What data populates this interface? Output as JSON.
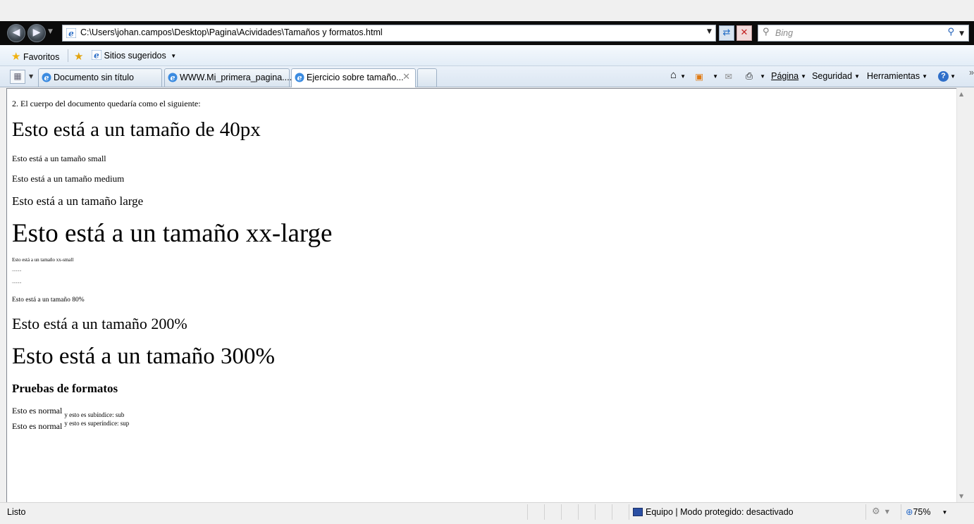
{
  "address_bar": {
    "url": "C:\\Users\\johan.campos\\Desktop\\Pagina\\Acividades\\Tamaños y formatos.html",
    "search_placeholder": "Bing"
  },
  "favorites_bar": {
    "favorites_label": "Favoritos",
    "suggested_label": "Sitios sugeridos"
  },
  "tabs": [
    {
      "label": "Documento sin título",
      "active": false
    },
    {
      "label": "WWW.Mi_primera_pagina....",
      "active": false
    },
    {
      "label": "Ejercicio sobre tamaño...",
      "active": true
    }
  ],
  "command_bar": {
    "page": "Página",
    "security": "Seguridad",
    "tools": "Herramientas",
    "chevron": "»"
  },
  "page": {
    "intro": "2. El cuerpo del documento quedaría como el siguiente:",
    "size_40px": "Esto está a un tamaño de 40px",
    "size_small": "Esto está a un tamaño small",
    "size_medium": "Esto está a un tamaño medium",
    "size_large": "Esto está a un tamaño large",
    "size_xx_large": "Esto está a un tamaño xx-large",
    "size_xx_small": "Esto está a un tamaño xx-small",
    "tiny_line_1": ".........",
    "tiny_line_2": ".........",
    "size_80": "Esto está a un tamaño 80%",
    "size_200": "Esto está a un tamaño 200%",
    "size_300": "Esto está a un tamaño 300%",
    "formats_heading": "Pruebas de formatos",
    "normal_1": "Esto es normal",
    "sub_text": "y esto es subíndice: sub",
    "normal_2": "Esto es normal",
    "sup_text": "y esto es superíndice: sup"
  },
  "status_bar": {
    "status": "Listo",
    "zone": "Equipo | Modo protegido: desactivado",
    "zoom": "75%"
  }
}
